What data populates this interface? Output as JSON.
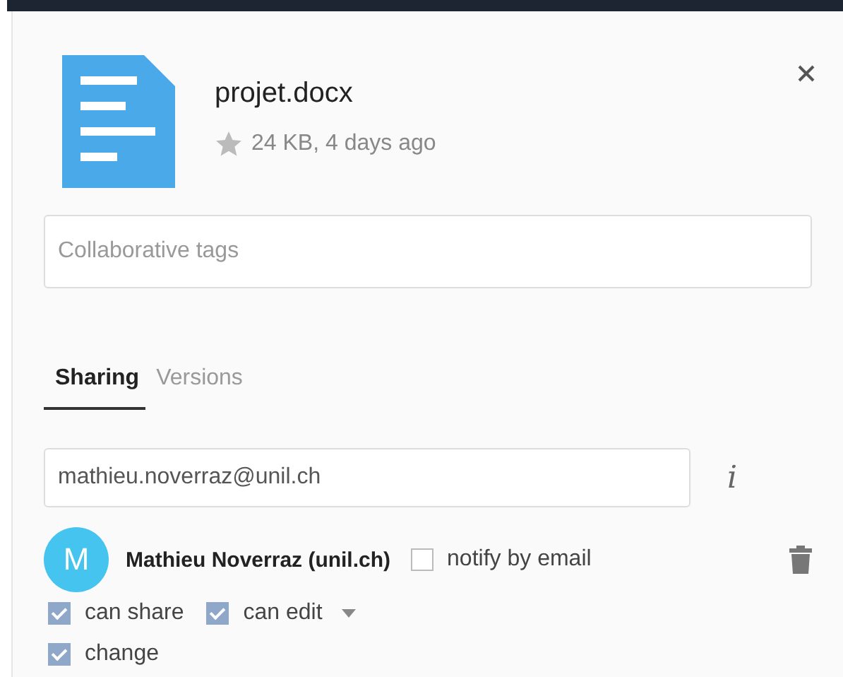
{
  "file": {
    "name": "projet.docx",
    "starred": false,
    "meta": "24 KB, 4 days ago"
  },
  "tags": {
    "placeholder": "Collaborative tags"
  },
  "tabs": [
    {
      "label": "Sharing",
      "selected": true
    },
    {
      "label": "Versions",
      "selected": false
    }
  ],
  "share_field": {
    "value": "mathieu.noverraz@unil.ch"
  },
  "share": {
    "avatar": "M",
    "name": "Mathieu Noverraz (unil.ch)",
    "notify": {
      "label": "notify by email",
      "checked": false
    },
    "permission_rows": [
      [
        {
          "label": "can share",
          "checked": true
        },
        {
          "label": "can edit",
          "checked": true,
          "menu": true
        }
      ],
      [
        {
          "label": "change",
          "checked": true
        }
      ]
    ]
  },
  "info_icon": "i"
}
